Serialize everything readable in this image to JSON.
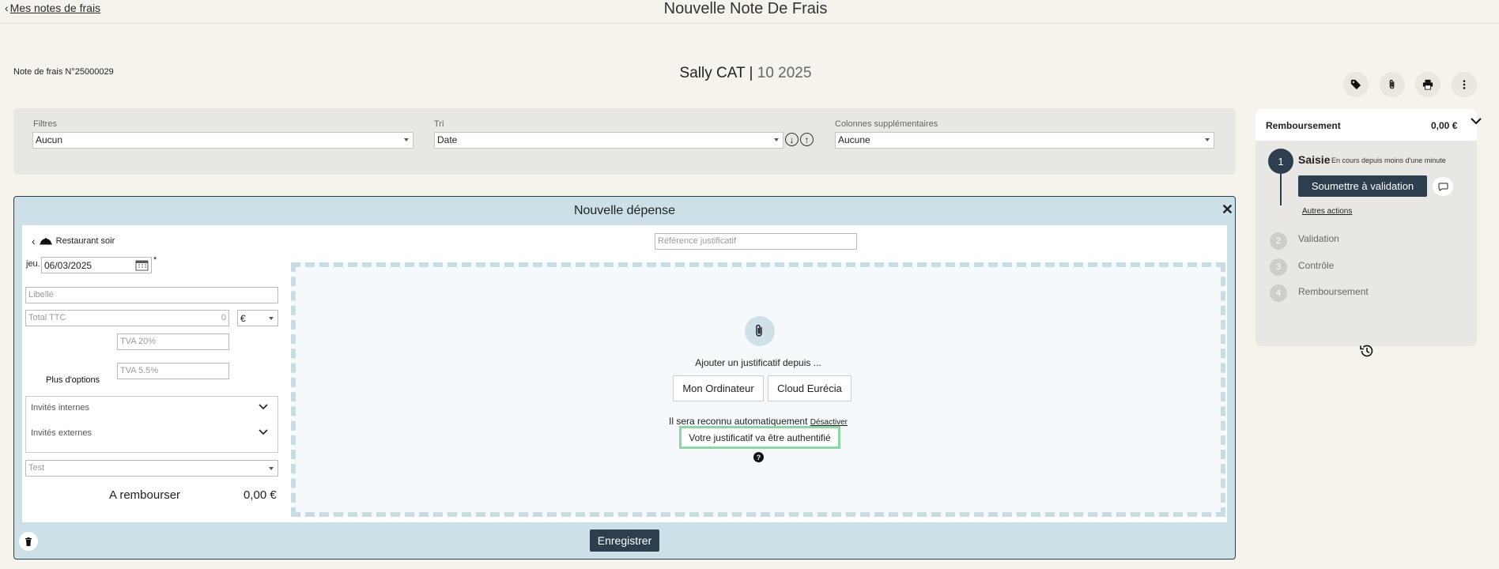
{
  "header": {
    "back_label": "Mes notes de frais",
    "title": "Nouvelle Note De Frais"
  },
  "note": {
    "number": "Note de frais N°25000029",
    "employee": "Sally CAT",
    "separator": "|",
    "period": "10 2025"
  },
  "filters": {
    "filtres_label": "Filtres",
    "filtres_value": "Aucun",
    "tri_label": "Tri",
    "tri_value": "Date",
    "columns_label": "Colonnes supplémentaires",
    "columns_value": "Aucune"
  },
  "expense": {
    "title": "Nouvelle dépense",
    "category": "Restaurant soir",
    "day": "jeu.",
    "date": "06/03/2025",
    "required_mark": "*",
    "reference_placeholder": "Référence justificatif",
    "libelle_placeholder": "Libellé",
    "total_placeholder": "Total TTC",
    "total_value": "0",
    "currency": "€",
    "tva20_placeholder": "TVA 20%",
    "tva55_placeholder": "TVA 5.5%",
    "more_options": "Plus d'options",
    "internal_guests": "Invités internes",
    "external_guests": "Invités externes",
    "project_value": "Test",
    "to_refund_label": "A rembourser",
    "to_refund_amount": "0,00 €",
    "upload_prompt": "Ajouter un justificatif depuis ...",
    "btn_computer": "Mon Ordinateur",
    "btn_cloud": "Cloud Eurécia",
    "auto_recognition": "Il sera reconnu automatiquement",
    "deactivate": "Désactiver",
    "authenticated_notice": "Votre justificatif va être authentifié",
    "save": "Enregistrer"
  },
  "workflow": {
    "title": "Remboursement",
    "amount": "0,00 €",
    "steps": [
      {
        "num": "1",
        "label": "Saisie",
        "status": "En cours depuis moins d'une minute"
      },
      {
        "num": "2",
        "label": "Validation"
      },
      {
        "num": "3",
        "label": "Contrôle"
      },
      {
        "num": "4",
        "label": "Remboursement"
      }
    ],
    "submit": "Soumettre à validation",
    "other_actions": "Autres actions"
  },
  "colors": {
    "background": "#f6f3ed",
    "primary": "#2d3f4e",
    "panel_blue": "#cce0e8",
    "success_border": "#8fd6a6"
  },
  "icons": [
    "chevron-left-icon",
    "tag-icon",
    "paperclip-icon",
    "print-icon",
    "more-vert-icon",
    "chevron-down-icon",
    "arrow-down-circle-icon",
    "arrow-up-circle-icon",
    "close-icon",
    "cloche-icon",
    "calendar-icon",
    "help-icon",
    "trash-icon",
    "comment-icon",
    "history-icon"
  ]
}
